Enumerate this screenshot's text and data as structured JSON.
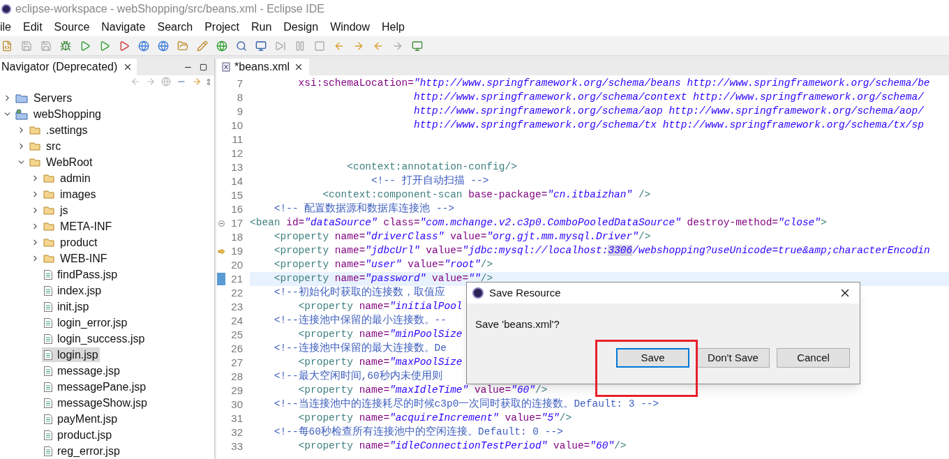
{
  "window": {
    "title": "eclipse-workspace - webShopping/src/beans.xml - Eclipse IDE"
  },
  "menu": [
    "ile",
    "Edit",
    "Source",
    "Navigate",
    "Search",
    "Project",
    "Run",
    "Design",
    "Window",
    "Help"
  ],
  "navigator": {
    "tab": "Navigator (Deprecated)",
    "tree": [
      {
        "label": "Servers",
        "kind": "servers",
        "expanded": false,
        "selected": false
      },
      {
        "label": "webShopping",
        "kind": "project",
        "expanded": true,
        "selected": false,
        "children": [
          {
            "label": ".settings",
            "kind": "folder",
            "expanded": false,
            "selected": false
          },
          {
            "label": "src",
            "kind": "folder",
            "expanded": false,
            "selected": false
          },
          {
            "label": "WebRoot",
            "kind": "folder",
            "expanded": true,
            "selected": false,
            "children": [
              {
                "label": "admin",
                "kind": "folder",
                "expanded": false,
                "selected": false
              },
              {
                "label": "images",
                "kind": "folder",
                "expanded": false,
                "selected": false
              },
              {
                "label": "js",
                "kind": "folder",
                "expanded": false,
                "selected": false
              },
              {
                "label": "META-INF",
                "kind": "folder",
                "expanded": false,
                "selected": false
              },
              {
                "label": "product",
                "kind": "folder",
                "expanded": false,
                "selected": false
              },
              {
                "label": "WEB-INF",
                "kind": "folder",
                "expanded": false,
                "selected": false
              },
              {
                "label": "findPass.jsp",
                "kind": "file",
                "selected": false
              },
              {
                "label": "index.jsp",
                "kind": "file",
                "selected": false
              },
              {
                "label": "init.jsp",
                "kind": "file",
                "selected": false
              },
              {
                "label": "login_error.jsp",
                "kind": "file",
                "selected": false
              },
              {
                "label": "login_success.jsp",
                "kind": "file",
                "selected": false
              },
              {
                "label": "login.jsp",
                "kind": "file",
                "selected": true
              },
              {
                "label": "message.jsp",
                "kind": "file",
                "selected": false
              },
              {
                "label": "messagePane.jsp",
                "kind": "file",
                "selected": false
              },
              {
                "label": "messageShow.jsp",
                "kind": "file",
                "selected": false
              },
              {
                "label": "payMent.jsp",
                "kind": "file",
                "selected": false
              },
              {
                "label": "product.jsp",
                "kind": "file",
                "selected": false
              },
              {
                "label": "reg_error.jsp",
                "kind": "file",
                "selected": false
              }
            ]
          }
        ]
      }
    ]
  },
  "editor": {
    "tab": "*beans.xml",
    "lines": [
      {
        "number": "7",
        "tokens": [
          {
            "kind": "attr",
            "text": "        xsi:schemaLocation="
          },
          {
            "kind": "value",
            "text": "\"http://www.springframework.org/schema/beans http://www.springframework.org/schema/be"
          }
        ]
      },
      {
        "number": "8",
        "tokens": [
          {
            "kind": "value",
            "text": "                           http://www.springframework.org/schema/context http://www.springframework.org/schema/"
          }
        ]
      },
      {
        "number": "9",
        "tokens": [
          {
            "kind": "value",
            "text": "                           http://www.springframework.org/schema/aop http://www.springframework.org/schema/aop/"
          }
        ]
      },
      {
        "number": "10",
        "tokens": [
          {
            "kind": "value",
            "text": "                           http://www.springframework.org/schema/tx http://www.springframework.org/schema/tx/sp"
          }
        ]
      },
      {
        "number": "11",
        "kind": "plain"
      },
      {
        "number": "12",
        "kind": "plain"
      },
      {
        "number": "13",
        "tokens": [
          {
            "kind": "tag",
            "text": "                <context:annotation-config/>"
          }
        ]
      },
      {
        "number": "14",
        "tokens": [
          {
            "kind": "comment",
            "text": "                    <!-- 打开自动扫描 -->"
          }
        ]
      },
      {
        "number": "15",
        "tokens": [
          {
            "kind": "tag",
            "text": "            <context:component-scan "
          },
          {
            "kind": "attr",
            "text": "base-package="
          },
          {
            "kind": "value",
            "text": "\"cn.itbaizhan\""
          },
          {
            "kind": "tag",
            "text": " />"
          }
        ]
      },
      {
        "number": "16",
        "tokens": [
          {
            "kind": "comment",
            "text": "    <!-- 配置数据源和数据库连接池 -->"
          }
        ]
      },
      {
        "number": "17",
        "kind": "fold",
        "tokens": [
          {
            "kind": "tag",
            "text": "<bean "
          },
          {
            "kind": "attr",
            "text": "id="
          },
          {
            "kind": "value",
            "text": "\"dataSource\""
          },
          {
            "kind": "attr",
            "text": " class="
          },
          {
            "kind": "value",
            "text": "\"com.mchange.v2.c3p0.ComboPooledDataSource\""
          },
          {
            "kind": "attr",
            "text": " destroy-method="
          },
          {
            "kind": "value",
            "text": "\"close\""
          },
          {
            "kind": "tag",
            "text": ">"
          }
        ]
      },
      {
        "number": "18",
        "tokens": [
          {
            "kind": "tag",
            "text": "    <property "
          },
          {
            "kind": "attr",
            "text": "name="
          },
          {
            "kind": "value",
            "text": "\"driverClass\""
          },
          {
            "kind": "attr",
            "text": " value="
          },
          {
            "kind": "value",
            "text": "\"org.gjt.mm.mysql.Driver\""
          },
          {
            "kind": "tag",
            "text": "/>"
          }
        ]
      },
      {
        "number": "19",
        "kind": "arrow",
        "tokens": [
          {
            "kind": "tag",
            "text": "    <property "
          },
          {
            "kind": "attr",
            "text": "name="
          },
          {
            "kind": "value",
            "text": "\"jdbcUrl\""
          },
          {
            "kind": "attr",
            "text": " value="
          },
          {
            "kind": "value",
            "text": "\"jdbc:mysql://localhost:"
          },
          {
            "kind": "match",
            "text": "3306"
          },
          {
            "kind": "value",
            "text": "/webshopping?useUnicode=true&amp;characterEncodin"
          }
        ]
      },
      {
        "number": "20",
        "tokens": [
          {
            "kind": "tag",
            "text": "    <property "
          },
          {
            "kind": "attr",
            "text": "name="
          },
          {
            "kind": "value",
            "text": "\"user\""
          },
          {
            "kind": "attr",
            "text": " value="
          },
          {
            "kind": "value",
            "text": "\"root\""
          },
          {
            "kind": "tag",
            "text": "/>"
          }
        ]
      },
      {
        "number": "21",
        "kind": "cursor",
        "tokens": [
          {
            "kind": "tag",
            "text": "    <property "
          },
          {
            "kind": "attr",
            "text": "name="
          },
          {
            "kind": "value",
            "text": "\"password\""
          },
          {
            "kind": "attr",
            "text": " value="
          },
          {
            "kind": "value",
            "text": "\"\""
          },
          {
            "kind": "tag",
            "text": "/>"
          }
        ]
      },
      {
        "number": "22",
        "tokens": [
          {
            "kind": "comment",
            "text": "    <!--初始化时获取的连接数，取值应"
          }
        ]
      },
      {
        "number": "23",
        "tokens": [
          {
            "kind": "tag",
            "text": "        <property "
          },
          {
            "kind": "attr",
            "text": "name="
          },
          {
            "kind": "value",
            "text": "\"initialPool"
          }
        ]
      },
      {
        "number": "24",
        "tokens": [
          {
            "kind": "comment",
            "text": "    <!--连接池中保留的最小连接数。--"
          }
        ]
      },
      {
        "number": "25",
        "tokens": [
          {
            "kind": "tag",
            "text": "        <property "
          },
          {
            "kind": "attr",
            "text": "name="
          },
          {
            "kind": "value",
            "text": "\"minPoolSize"
          }
        ]
      },
      {
        "number": "26",
        "tokens": [
          {
            "kind": "comment",
            "text": "    <!--连接池中保留的最大连接数。De"
          }
        ]
      },
      {
        "number": "27",
        "tokens": [
          {
            "kind": "tag",
            "text": "        <property "
          },
          {
            "kind": "attr",
            "text": "name="
          },
          {
            "kind": "value",
            "text": "\"maxPoolSize"
          }
        ]
      },
      {
        "number": "28",
        "tokens": [
          {
            "kind": "comment",
            "text": "    <!--最大空闲时间,60秒内未使用则"
          }
        ]
      },
      {
        "number": "29",
        "tokens": [
          {
            "kind": "tag",
            "text": "        <property "
          },
          {
            "kind": "attr",
            "text": "name="
          },
          {
            "kind": "value",
            "text": "\"maxIdleTime\""
          },
          {
            "kind": "attr",
            "text": " value="
          },
          {
            "kind": "value",
            "text": "\"60\""
          },
          {
            "kind": "tag",
            "text": "/>"
          }
        ]
      },
      {
        "number": "30",
        "tokens": [
          {
            "kind": "comment",
            "text": "    <!--当连接池中的连接耗尽的时候c3p0一次同时获取的连接数。Default: 3 -->"
          }
        ]
      },
      {
        "number": "31",
        "tokens": [
          {
            "kind": "tag",
            "text": "        <property "
          },
          {
            "kind": "attr",
            "text": "name="
          },
          {
            "kind": "value",
            "text": "\"acquireIncrement\""
          },
          {
            "kind": "attr",
            "text": " value="
          },
          {
            "kind": "value",
            "text": "\"5\""
          },
          {
            "kind": "tag",
            "text": "/>"
          }
        ]
      },
      {
        "number": "32",
        "tokens": [
          {
            "kind": "comment",
            "text": "    <!--每60秒检查所有连接池中的空闲连接。Default: 0 -->"
          }
        ]
      },
      {
        "number": "33",
        "tokens": [
          {
            "kind": "tag",
            "text": "        <property "
          },
          {
            "kind": "attr",
            "text": "name="
          },
          {
            "kind": "value",
            "text": "\"idleConnectionTestPeriod\""
          },
          {
            "kind": "attr",
            "text": " value="
          },
          {
            "kind": "value",
            "text": "\"60\""
          },
          {
            "kind": "tag",
            "text": "/>"
          }
        ]
      }
    ]
  },
  "dialog": {
    "title": "Save Resource",
    "message": "Save 'beans.xml'?",
    "buttons": [
      {
        "label": "Save",
        "default": true
      },
      {
        "label": "Don't Save",
        "default": false
      },
      {
        "label": "Cancel",
        "default": false
      }
    ]
  }
}
